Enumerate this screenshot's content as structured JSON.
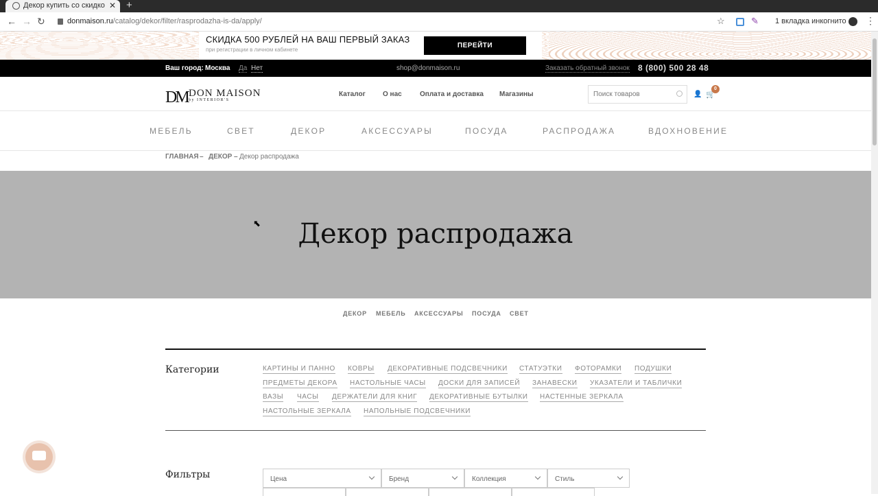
{
  "browser": {
    "tab_title": "Декор купить со скидко",
    "url_host": "donmaison.ru",
    "url_path": "/catalog/dekor/filter/rasprodazha-is-da/apply/",
    "incognito": "1 вкладка инкогнито"
  },
  "promo": {
    "title": "СКИДКА 500 РУБЛЕЙ НА ВАШ ПЕРВЫЙ ЗАКАЗ",
    "subtitle": "при регистрации в личном кабинете",
    "button": "ПЕРЕЙТИ"
  },
  "topbar": {
    "city_label": "Ваш город:",
    "city": "Москва",
    "yes": "Да",
    "no": "Нет",
    "email": "shop@donmaison.ru",
    "callback": "Заказать обратный звонок",
    "phone": "8 (800) 500 28 48"
  },
  "header": {
    "logo_mark": "DM",
    "logo_name": "DON MAISON",
    "logo_sub": "by INTERIOR'S",
    "nav": [
      "Каталог",
      "О нас",
      "Оплата и доставка",
      "Магазины"
    ],
    "search_placeholder": "Поиск товаров",
    "cart_count": "0"
  },
  "main_menu": [
    "МЕБЕЛЬ",
    "СВЕТ",
    "ДЕКОР",
    "АКСЕССУАРЫ",
    "ПОСУДА",
    "РАСПРОДАЖА",
    "ВДОХНОВЕНИЕ"
  ],
  "breadcrumb": {
    "home": "ГЛАВНАЯ",
    "sep1": "–",
    "decor": "ДЕКОР",
    "sep2": "–",
    "current": "Декор распродажа"
  },
  "hero": {
    "title": "Декор распродажа"
  },
  "section_tabs": [
    "ДЕКОР",
    "МЕБЕЛЬ",
    "АКСЕССУАРЫ",
    "ПОСУДА",
    "СВЕТ"
  ],
  "categories": {
    "title": "Категории",
    "items": [
      "КАРТИНЫ И ПАННО",
      "КОВРЫ",
      "ДЕКОРАТИВНЫЕ ПОДСВЕЧНИКИ",
      "СТАТУЭТКИ",
      "ФОТОРАМКИ",
      "ПОДУШКИ",
      "ПРЕДМЕТЫ ДЕКОРА",
      "НАСТОЛЬНЫЕ ЧАСЫ",
      "ДОСКИ ДЛЯ ЗАПИСЕЙ",
      "ЗАНАВЕСКИ",
      "УКАЗАТЕЛИ И ТАБЛИЧКИ",
      "ВАЗЫ",
      "ЧАСЫ",
      "ДЕРЖАТЕЛИ ДЛЯ КНИГ",
      "ДЕКОРАТИВНЫЕ БУТЫЛКИ",
      "НАСТЕННЫЕ ЗЕРКАЛА",
      "НАСТОЛЬНЫЕ ЗЕРКАЛА",
      "НАПОЛЬНЫЕ ПОДСВЕЧНИКИ"
    ]
  },
  "filters": {
    "title": "Фильтры",
    "items": [
      "Цена",
      "Бренд",
      "Коллекция",
      "Стиль"
    ]
  },
  "colors": {
    "accent": "#c8784a",
    "hero_bg": "#b3b3b3"
  }
}
